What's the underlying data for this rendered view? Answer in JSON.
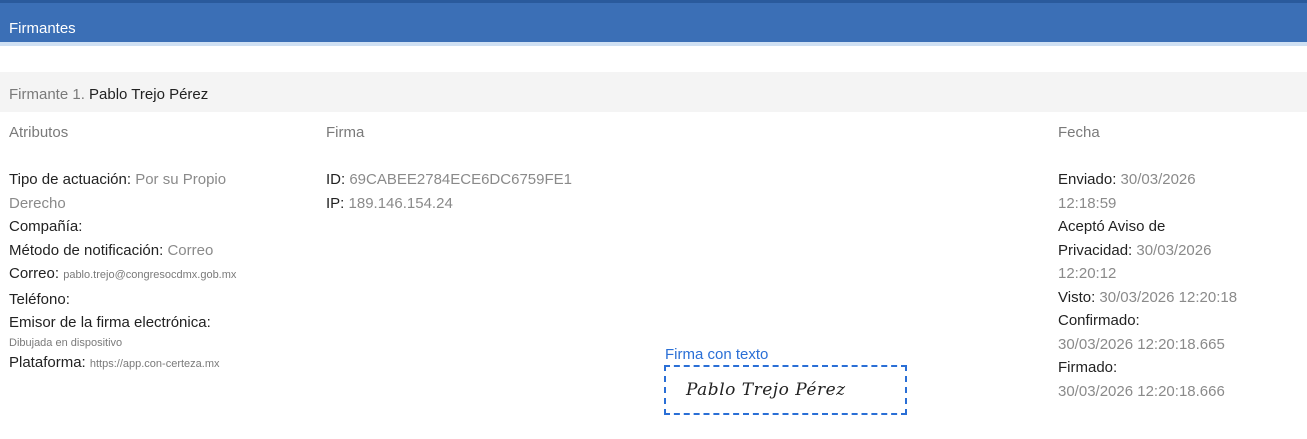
{
  "header": {
    "title": "Firmantes"
  },
  "signer": {
    "prefix": "Firmante 1.",
    "name": "Pablo Trejo Pérez"
  },
  "columns": {
    "attributes": "Atributos",
    "signature": "Firma",
    "date": "Fecha"
  },
  "attributes": {
    "tipo_label": "Tipo de actuación:",
    "tipo_value": "Por su Propio",
    "tipo_value_2": "Derecho",
    "compania_label": "Compañía:",
    "metodo_label": "Método de notificación:",
    "metodo_value": "Correo",
    "correo_label": "Correo:",
    "correo_value": "pablo.trejo@congresocdmx.gob.mx",
    "telefono_label": "Teléfono:",
    "emisor_label": "Emisor de la firma electrónica:",
    "emisor_value": "Dibujada en dispositivo",
    "plataforma_label": "Plataforma:",
    "plataforma_value": "https://app.con-certeza.mx"
  },
  "signature": {
    "id_label": "ID:",
    "id_value": "69CABEE2784ECE6DC6759FE1",
    "ip_label": "IP:",
    "ip_value": "189.146.154.24",
    "caption": "Firma con texto",
    "drawn_name": "Pablo Trejo Pérez"
  },
  "dates": {
    "enviado_label": "Enviado:",
    "enviado_date": "30/03/2026",
    "enviado_time": "12:18:59",
    "acepto_label_1": "Aceptó Aviso de",
    "acepto_label_2": "Privacidad:",
    "acepto_date": "30/03/2026",
    "acepto_time": "12:20:12",
    "visto_label": "Visto:",
    "visto_value": "30/03/2026 12:20:18",
    "confirmado_label": "Confirmado:",
    "confirmado_value": "30/03/2026 12:20:18.665",
    "firmado_label": "Firmado:",
    "firmado_value": "30/03/2026 12:20:18.666"
  }
}
